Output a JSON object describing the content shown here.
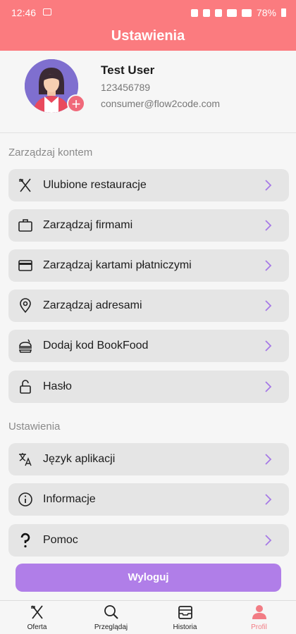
{
  "status": {
    "time": "12:46",
    "battery": "78%"
  },
  "appbar": {
    "title": "Ustawienia"
  },
  "profile": {
    "name": "Test User",
    "phone": "123456789",
    "email": "consumer@flow2code.com"
  },
  "sections": {
    "account_title": "Zarządzaj kontem",
    "settings_title": "Ustawienia"
  },
  "menu": {
    "favorites": "Ulubione restauracje",
    "companies": "Zarządzaj firmami",
    "cards": "Zarządzaj kartami płatniczymi",
    "addresses": "Zarządzaj adresami",
    "bookfood": "Dodaj kod BookFood",
    "password": "Hasło",
    "language": "Język aplikacji",
    "info": "Informacje",
    "help": "Pomoc"
  },
  "logout_label": "Wyloguj",
  "nav": {
    "offer": "Oferta",
    "browse": "Przeglądaj",
    "history": "Historia",
    "profile": "Profil"
  },
  "colors": {
    "accent": "#fb7b7f",
    "button": "#b07ee8",
    "chevron": "#a679e6"
  }
}
